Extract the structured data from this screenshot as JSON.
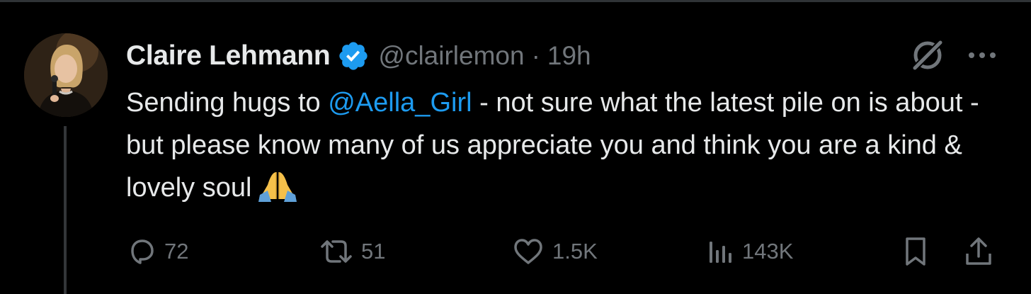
{
  "tweet": {
    "author_name": "Claire Lehmann",
    "handle": "@clairlemon",
    "separator": "·",
    "time": "19h",
    "text_before": "Sending hugs to ",
    "mention": "@Aella_Girl",
    "text_after": " - not sure what the latest pile on is about - but please know many of us appreciate you and think you are a kind & lovely soul",
    "emoji": "folded-hands-emoji"
  },
  "actions": {
    "replies": "72",
    "reposts": "51",
    "likes": "1.5K",
    "views": "143K"
  },
  "colors": {
    "background": "#000000",
    "text": "#e7e9ea",
    "secondary": "#71767b",
    "accent": "#1d9bf0",
    "verified": "#1d9bf0",
    "thread_line": "#333639"
  }
}
